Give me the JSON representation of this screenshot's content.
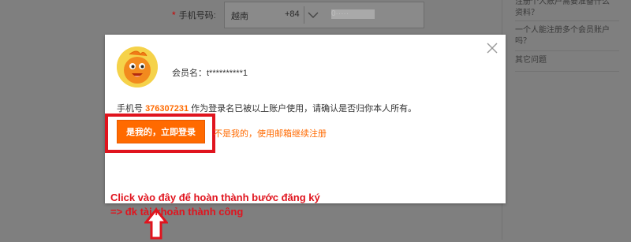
{
  "registration_form": {
    "phone_label": "手机号码:",
    "required_mark": "*",
    "country": "越南",
    "country_code": "+84",
    "phone_masked": "0·····"
  },
  "faq": {
    "items": [
      "注册个人账户需要准备什么资料？",
      "一个人能注册多个会员账户吗？",
      "其它问题"
    ]
  },
  "dialog": {
    "member_label": "会员名：t**********1",
    "notice_prefix": "手机号 ",
    "phone_number": "376307231",
    "notice_suffix": " 作为登录名已被以上账户使用，请确认是否归你本人所有。",
    "primary_button": "是我的，立即登录",
    "alt_link": "不是我的，使用邮箱继续注册"
  },
  "annotation": {
    "line1": "Click vào đây để hoàn thành bước đăng ký",
    "line2": "=> đk tài khoản thành công"
  },
  "colors": {
    "accent": "#ff6a00",
    "annotation": "#e0141e",
    "overlay": "#7f7f7f"
  }
}
